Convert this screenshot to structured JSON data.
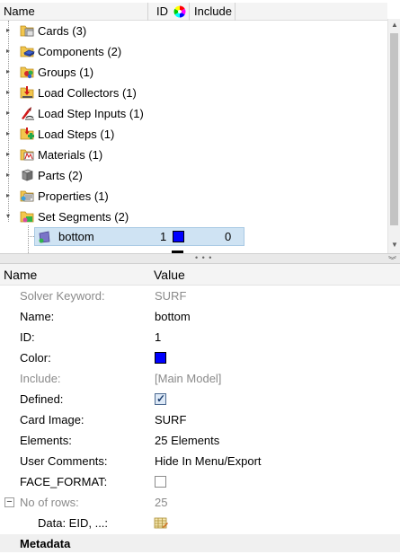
{
  "tree": {
    "columns": {
      "name": "Name",
      "id": "ID",
      "include": "Include"
    },
    "items": [
      {
        "label": "Cards (3)",
        "icon": "cards-icon",
        "expanded": false
      },
      {
        "label": "Components (2)",
        "icon": "components-icon",
        "expanded": false
      },
      {
        "label": "Groups (1)",
        "icon": "groups-icon",
        "expanded": false
      },
      {
        "label": "Load Collectors (1)",
        "icon": "load-collectors-icon",
        "expanded": false
      },
      {
        "label": "Load Step Inputs (1)",
        "icon": "load-step-inputs-icon",
        "expanded": false
      },
      {
        "label": "Load Steps (1)",
        "icon": "load-steps-icon",
        "expanded": false
      },
      {
        "label": "Materials (1)",
        "icon": "materials-icon",
        "expanded": false
      },
      {
        "label": "Parts (2)",
        "icon": "parts-icon",
        "expanded": false
      },
      {
        "label": "Properties (1)",
        "icon": "properties-icon",
        "expanded": false
      },
      {
        "label": "Set Segments (2)",
        "icon": "set-segments-icon",
        "expanded": true
      }
    ],
    "selected_child": {
      "label": "bottom",
      "id": "1",
      "include": "0",
      "color": "#0000ff"
    }
  },
  "props": {
    "columns": {
      "name": "Name",
      "value": "Value"
    },
    "rows": {
      "solver_keyword": {
        "name": "Solver Keyword:",
        "value": "SURF"
      },
      "name": {
        "name": "Name:",
        "value": "bottom"
      },
      "id": {
        "name": "ID:",
        "value": "1"
      },
      "color": {
        "name": "Color:",
        "value": "#0000ff"
      },
      "include": {
        "name": "Include:",
        "value": "[Main Model]"
      },
      "defined": {
        "name": "Defined:",
        "checked": true
      },
      "card_image": {
        "name": "Card Image:",
        "value": "SURF"
      },
      "elements": {
        "name": "Elements:",
        "value": "25 Elements"
      },
      "user_comments": {
        "name": "User Comments:",
        "value": "Hide In Menu/Export"
      },
      "face_format": {
        "name": "FACE_FORMAT:",
        "checked": false
      },
      "no_of_rows": {
        "name": "No of rows:",
        "value": "25"
      },
      "data": {
        "name": "Data: EID, ...:"
      }
    },
    "metadata_label": "Metadata"
  },
  "colors": {
    "selection": "#cfe3f3",
    "accent": "#0000ff"
  }
}
